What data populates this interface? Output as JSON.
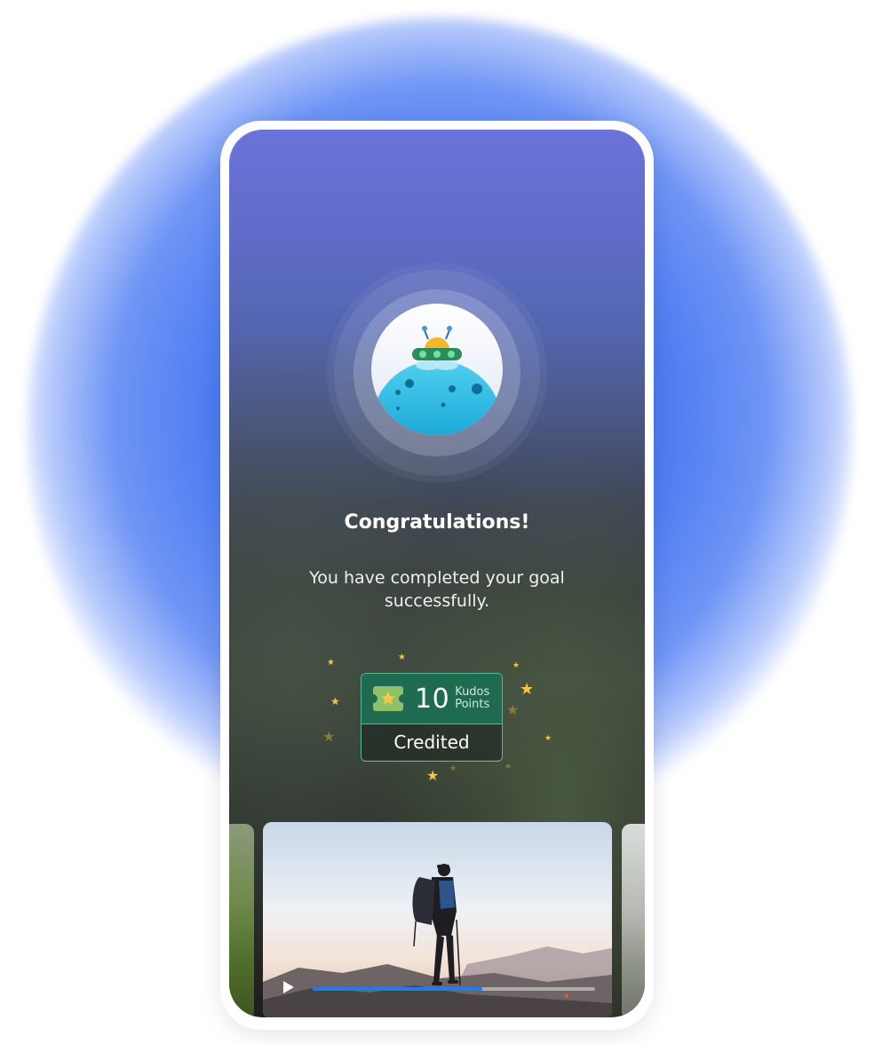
{
  "congrats": {
    "title": "Congratulations!",
    "subtitle": "You have completed your goal successfully."
  },
  "reward": {
    "points": "10",
    "unit_line1": "Kudos",
    "unit_line2": "Points",
    "status": "Credited",
    "icon": "ticket-star-icon"
  },
  "video": {
    "progress": 0.6,
    "play_icon": "play-icon",
    "progress_color": "#1f7bf2"
  },
  "colors": {
    "accent_glow": "#4d7cf2",
    "reward_green": "#1f6b52",
    "reward_border": "#5ab98b",
    "star": "#f5c542"
  }
}
